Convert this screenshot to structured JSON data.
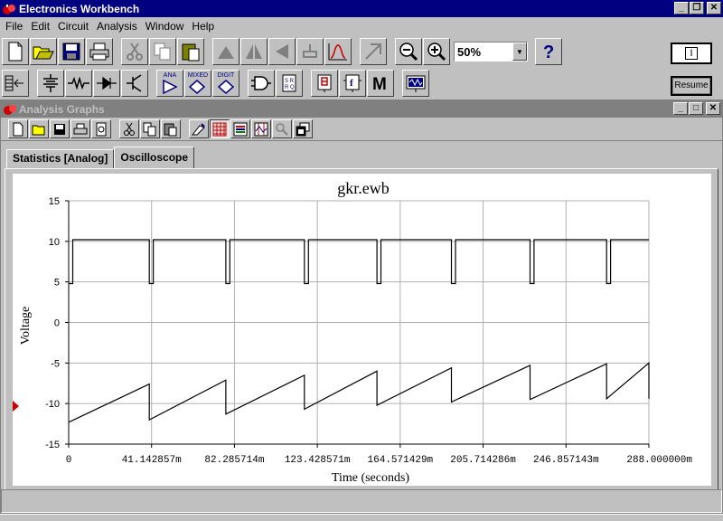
{
  "app": {
    "title": "Electronics Workbench",
    "menu": [
      "File",
      "Edit",
      "Circuit",
      "Analysis",
      "Window",
      "Help"
    ],
    "zoom": "50%",
    "power_switch": "I",
    "resume_label": "Resume",
    "parts_bins": [
      "ANA",
      "MIXED",
      "DIGIT"
    ]
  },
  "analysis_window": {
    "title": "Analysis Graphs",
    "tabs": [
      "Statistics [Analog]",
      "Oscilloscope"
    ],
    "selected_tab": "Oscilloscope"
  },
  "chart_data": {
    "type": "line",
    "title": "gkr.ewb",
    "xlabel": "Time (seconds)",
    "ylabel": "Voltage",
    "xlim": [
      0,
      0.288
    ],
    "ylim": [
      -15,
      15
    ],
    "grid": true,
    "x_tick_labels": [
      "0",
      "41.142857m",
      "82.285714m",
      "123.428571m",
      "164.571429m",
      "205.714286m",
      "246.857143m",
      "288.000000m"
    ],
    "y_tick_labels": [
      "15",
      "10",
      "5",
      "0",
      "-5",
      "-10",
      "-15"
    ],
    "y_ticks": [
      15,
      10,
      5,
      0,
      -5,
      -10,
      -15
    ],
    "x_ticks": [
      0,
      0.041142857,
      0.082285714,
      0.123428571,
      0.164571429,
      0.205714286,
      0.246857143,
      0.288
    ],
    "series": [
      {
        "style": "square",
        "color": "#000000",
        "high": 10.2,
        "low": 4.8,
        "edges": [
          0.002,
          0.04,
          0.042,
          0.078,
          0.08,
          0.117,
          0.119,
          0.153,
          0.155,
          0.19,
          0.192,
          0.229,
          0.231,
          0.267,
          0.269,
          0.288
        ]
      },
      {
        "style": "sawtooth",
        "color": "#000000",
        "points": [
          [
            0,
            -12.3
          ],
          [
            0.04,
            -7.6
          ],
          [
            0.04,
            -12.0
          ],
          [
            0.078,
            -7.1
          ],
          [
            0.078,
            -11.3
          ],
          [
            0.117,
            -6.5
          ],
          [
            0.117,
            -10.7
          ],
          [
            0.153,
            -6.0
          ],
          [
            0.153,
            -10.2
          ],
          [
            0.19,
            -5.6
          ],
          [
            0.19,
            -9.8
          ],
          [
            0.229,
            -5.3
          ],
          [
            0.229,
            -9.5
          ],
          [
            0.267,
            -5.1
          ],
          [
            0.267,
            -9.4
          ],
          [
            0.288,
            -5.0
          ],
          [
            0.288,
            -9.4
          ]
        ]
      }
    ]
  },
  "colors": {
    "titlebar_active": "#000080",
    "titlebar_inactive": "#808080",
    "face": "#c0c0c0",
    "cursor_marker": "#cc0000"
  }
}
